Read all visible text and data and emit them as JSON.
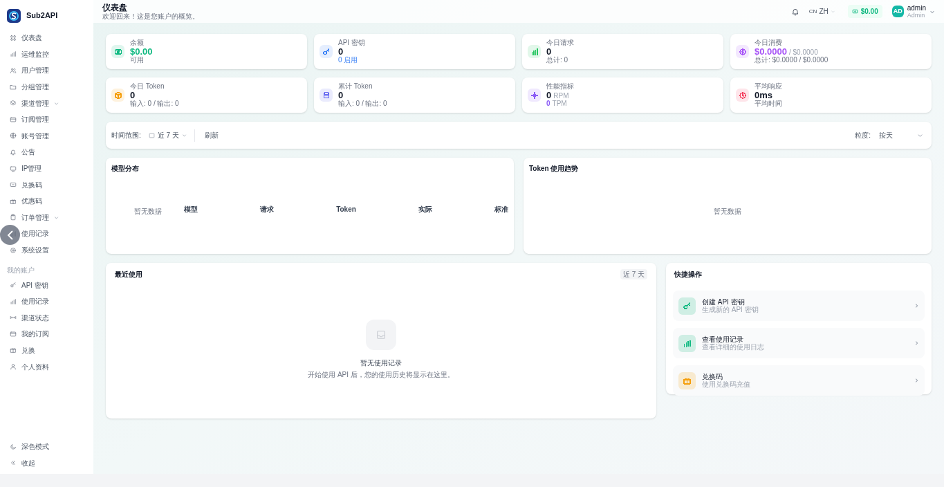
{
  "sidebar": {
    "brand": "Sub2API",
    "items": [
      {
        "label": "仪表盘",
        "expandable": false
      },
      {
        "label": "运维监控",
        "expandable": false
      },
      {
        "label": "用户管理",
        "expandable": false
      },
      {
        "label": "分组管理",
        "expandable": false
      },
      {
        "label": "渠道管理",
        "expandable": true
      },
      {
        "label": "订阅管理",
        "expandable": false
      },
      {
        "label": "账号管理",
        "expandable": false
      },
      {
        "label": "公告",
        "expandable": false
      },
      {
        "label": "IP管理",
        "expandable": false
      },
      {
        "label": "兑换码",
        "expandable": false
      },
      {
        "label": "优惠码",
        "expandable": false
      },
      {
        "label": "订单管理",
        "expandable": true
      },
      {
        "label": "使用记录",
        "expandable": false
      },
      {
        "label": "系统设置",
        "expandable": false
      }
    ],
    "section_title": "我的账户",
    "account_items": [
      {
        "label": "API 密钥"
      },
      {
        "label": "使用记录"
      },
      {
        "label": "渠道状态"
      },
      {
        "label": "我的订阅"
      },
      {
        "label": "兑换"
      },
      {
        "label": "个人资料"
      }
    ],
    "footer_items": [
      {
        "label": "深色模式"
      },
      {
        "label": "收起"
      }
    ]
  },
  "header": {
    "title": "仪表盘",
    "subtitle": "欢迎回来！这是您账户的概览。",
    "lang_flag": "CN",
    "lang": "ZH",
    "balance": "$0.00",
    "avatar": "AD",
    "user": "admin",
    "role": "Admin"
  },
  "stats": [
    {
      "label": "余额",
      "value": "$0.00",
      "sub": "可用",
      "color": "#10b981"
    },
    {
      "label": "API 密钥",
      "value": "0",
      "sub": "0 启用",
      "color": "#3b82f6"
    },
    {
      "label": "今日请求",
      "value": "0",
      "sub": "总计: 0",
      "color": "#22c55e"
    },
    {
      "label": "今日消费",
      "value": "$0.0000",
      "value_extra": "/ $0.0000",
      "sub": "总计: $0.0000 / $0.0000",
      "color": "#a855f7"
    },
    {
      "label": "今日 Token",
      "value": "0",
      "sub": "输入: 0 / 输出: 0",
      "color": "#f59e0b"
    },
    {
      "label": "累计 Token",
      "value": "0",
      "sub": "输入: 0 / 输出: 0",
      "color": "#6366f1"
    },
    {
      "label": "性能指标",
      "value": "0",
      "value_extra": "RPM",
      "sub": "0",
      "sub_extra": "TPM",
      "color": "#8b5cf6"
    },
    {
      "label": "平均响应",
      "value": "0ms",
      "sub": "平均时间",
      "color": "#f43f5e"
    }
  ],
  "filter": {
    "range_label": "时间范围:",
    "range": "近 7 天",
    "refresh": "刷新",
    "granularity_label": "粒度:",
    "granularity": "按天"
  },
  "model_chart": {
    "title": "模型分布",
    "empty": "暂无数据",
    "columns": [
      "模型",
      "请求",
      "Token",
      "实际",
      "标准"
    ]
  },
  "token_chart": {
    "title": "Token 使用趋势",
    "empty": "暂无数据"
  },
  "recent": {
    "title": "最近使用",
    "badge": "近 7 天",
    "empty_title": "暂无使用记录",
    "empty_text": "开始使用 API 后，您的使用历史将显示在这里。"
  },
  "quick": {
    "title": "快捷操作",
    "actions": [
      {
        "title": "创建 API 密钥",
        "desc": "生成新的 API 密钥",
        "color": "#10b981"
      },
      {
        "title": "查看使用记录",
        "desc": "查看详细的使用日志",
        "color": "#10b981"
      },
      {
        "title": "兑换码",
        "desc": "使用兑换码充值",
        "color": "#f59e0b"
      }
    ]
  }
}
